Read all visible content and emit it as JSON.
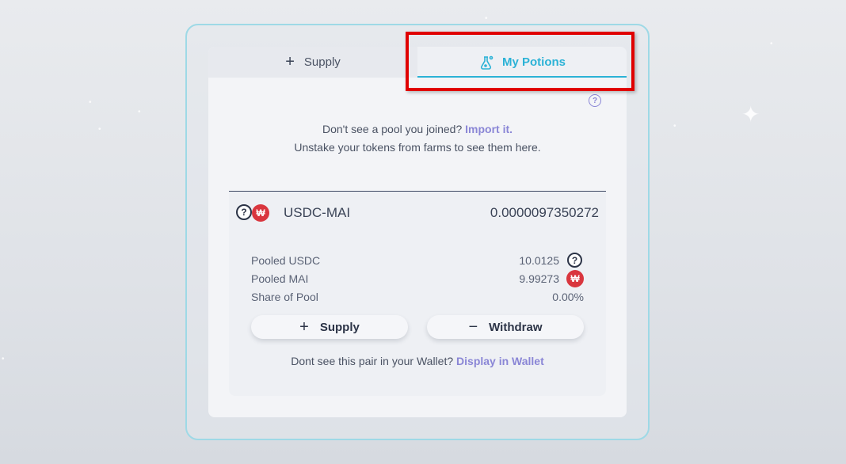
{
  "tabs": [
    {
      "label": "Supply",
      "icon": "plus-icon",
      "active": false
    },
    {
      "label": "My Potions",
      "icon": "flask-icon",
      "active": true
    }
  ],
  "notice": {
    "line1_prefix": "Don't see a pool you joined?",
    "line1_link": "Import it.",
    "line2": "Unstake your tokens from farms to see them here."
  },
  "position": {
    "pair_name": "USDC-MAI",
    "balance": "0.0000097350272",
    "token_icons": [
      "unknown-token-icon",
      "mai-token-icon"
    ],
    "rows": [
      {
        "label": "Pooled USDC",
        "value": "10.0125",
        "icon": "unknown-token-icon"
      },
      {
        "label": "Pooled MAI",
        "value": "9.99273",
        "icon": "mai-token-icon"
      },
      {
        "label": "Share of Pool",
        "value": "0.00%"
      }
    ],
    "supply_label": "Supply",
    "withdraw_label": "Withdraw"
  },
  "footer": {
    "prefix": "Dont see this pair in your Wallet?",
    "link": "Display in Wallet"
  },
  "colors": {
    "accent": "#2bb2d6",
    "link": "#8a86d6",
    "mai": "#d9363e",
    "highlight": "#e00000"
  }
}
